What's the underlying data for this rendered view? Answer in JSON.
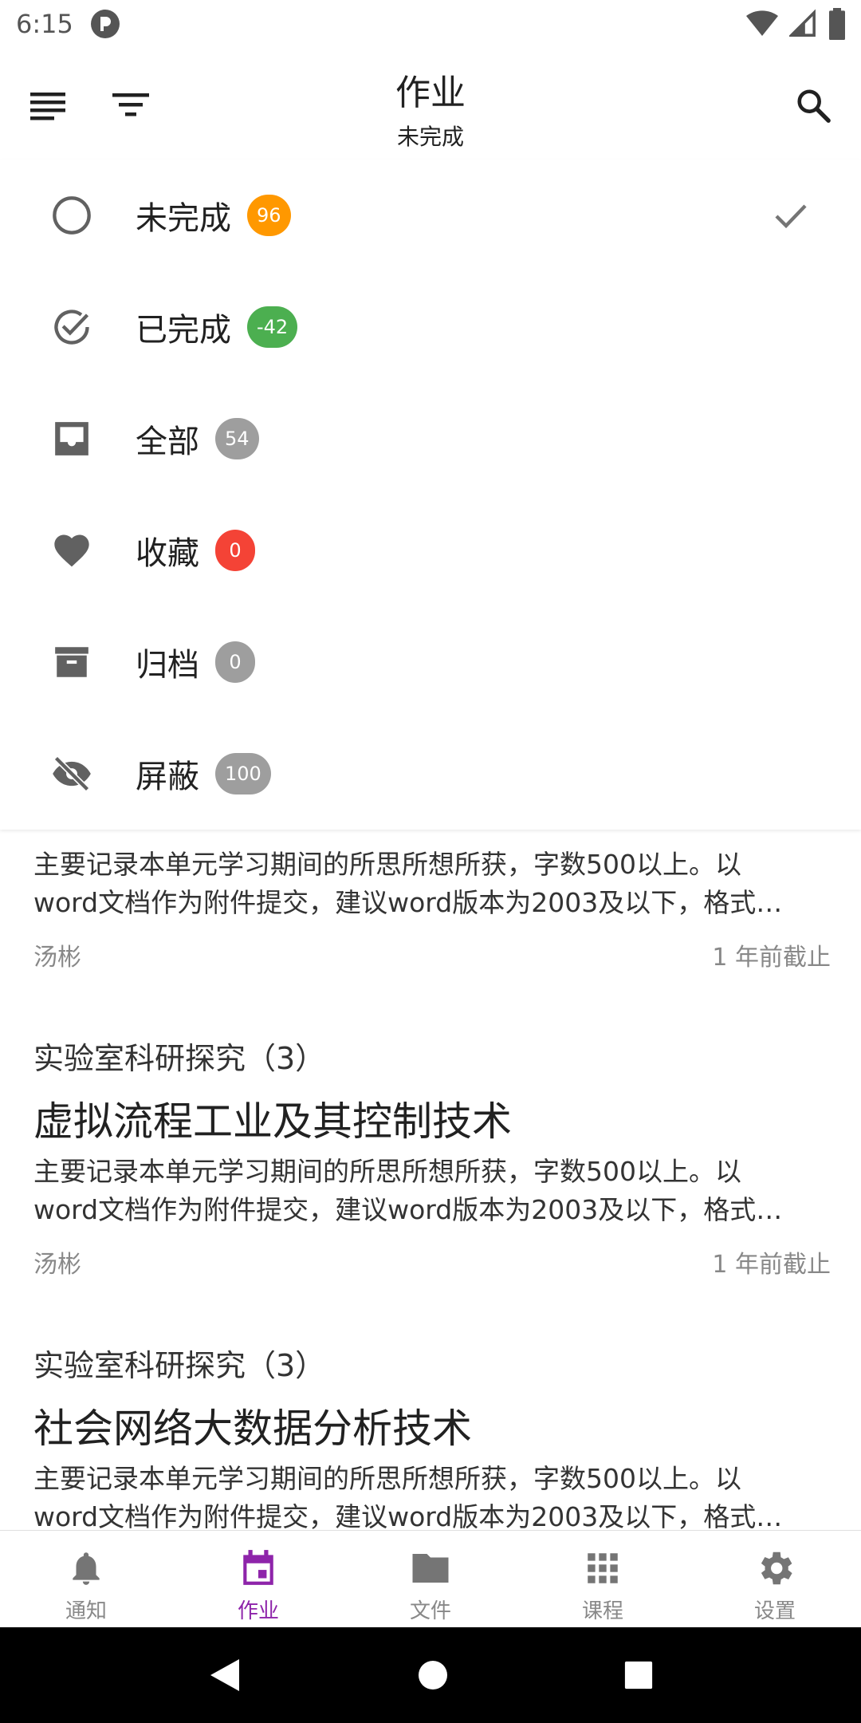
{
  "status_bar": {
    "time": "6:15"
  },
  "app_bar": {
    "title": "作业",
    "subtitle": "未完成"
  },
  "filters": [
    {
      "label": "未完成",
      "count": "96",
      "color": "#FF9800",
      "icon": "radio-unchecked-icon",
      "selected": true
    },
    {
      "label": "已完成",
      "count": "-42",
      "color": "#4CAF50",
      "icon": "check-circle-icon",
      "selected": false
    },
    {
      "label": "全部",
      "count": "54",
      "color": "#9E9E9E",
      "icon": "inbox-icon",
      "selected": false
    },
    {
      "label": "收藏",
      "count": "0",
      "color": "#F44336",
      "icon": "heart-icon",
      "selected": false
    },
    {
      "label": "归档",
      "count": "0",
      "color": "#9E9E9E",
      "icon": "archive-icon",
      "selected": false
    },
    {
      "label": "屏蔽",
      "count": "100",
      "color": "#9E9E9E",
      "icon": "eye-off-icon",
      "selected": false
    }
  ],
  "assignments": [
    {
      "course": "",
      "title": "",
      "desc_line1": "主要记录本单元学习期间的所思所想所获，字数500以上。以",
      "desc_line2": "word文档作为附件提交，建议word版本为2003及以下，格式…",
      "teacher": "汤彬",
      "due": "1 年前截止"
    },
    {
      "course": "实验室科研探究（3）",
      "title": "虚拟流程工业及其控制技术",
      "desc_line1": "主要记录本单元学习期间的所思所想所获，字数500以上。以",
      "desc_line2": "word文档作为附件提交，建议word版本为2003及以下，格式…",
      "teacher": "汤彬",
      "due": "1 年前截止"
    },
    {
      "course": "实验室科研探究（3）",
      "title": "社会网络大数据分析技术",
      "desc_line1": "主要记录本单元学习期间的所思所想所获，字数500以上。以",
      "desc_line2": "word文档作为附件提交，建议word版本为2003及以下，格式…"
    }
  ],
  "bottom_nav": [
    {
      "label": "通知",
      "icon": "bell-icon",
      "active": false
    },
    {
      "label": "作业",
      "icon": "calendar-icon",
      "active": true
    },
    {
      "label": "文件",
      "icon": "folder-icon",
      "active": false
    },
    {
      "label": "课程",
      "icon": "apps-grid-icon",
      "active": false
    },
    {
      "label": "设置",
      "icon": "gear-icon",
      "active": false
    }
  ],
  "colors": {
    "accent": "#8E24AA",
    "icon_gray": "#616161"
  }
}
